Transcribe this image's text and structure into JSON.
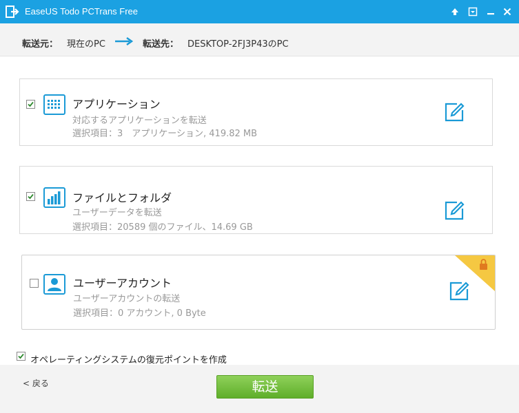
{
  "window": {
    "title": "EaseUS Todo PCTrans Free"
  },
  "route": {
    "source_label": "転送元：",
    "source_value": "現在のPC",
    "destination_label": "転送先：",
    "destination_value": "DESKTOP-2FJ3P43のPC"
  },
  "cards": [
    {
      "title": "アプリケーション",
      "description": "対応するアプリケーションを転送",
      "stats": "選択項目：3　アプリケーション, 419.82  MB",
      "checked": true,
      "icon": "grid-apps-icon"
    },
    {
      "title": "ファイルとフォルダ",
      "description": "ユーザーデータを転送",
      "stats": "選択項目：20589  個のファイル、14.69  GB",
      "checked": true,
      "icon": "bar-chart-icon"
    },
    {
      "title": "ユーザーアカウント",
      "description": "ユーザーアカウントの転送",
      "stats": "選択項目：0 アカウント, 0 Byte",
      "checked": false,
      "icon": "user-account-icon",
      "locked": true
    }
  ],
  "restore_point": {
    "label": "オペレーティングシステムの復元ポイントを作成",
    "checked": true
  },
  "footer": {
    "back_label": "< 戻る",
    "transfer_label": "転送"
  },
  "colors": {
    "titlebar": "#1ba1e2",
    "accent": "#1a9ad6",
    "transfer_button": "#6cbd35",
    "lock_badge": "#f5c842"
  }
}
